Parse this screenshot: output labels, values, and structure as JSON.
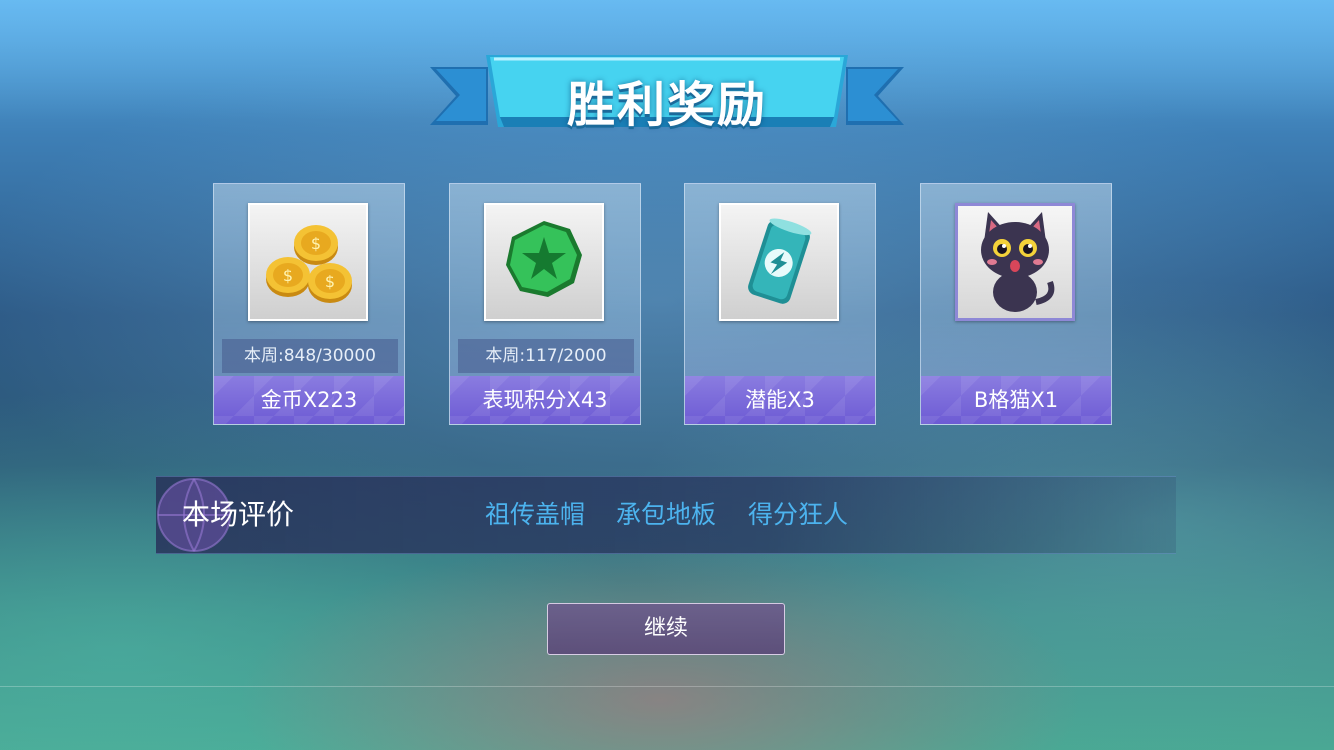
{
  "title": "胜利奖励",
  "rewards": [
    {
      "icon": "gold-coins-icon",
      "progress": "本周:848/30000",
      "label": "金币X223"
    },
    {
      "icon": "green-star-badge-icon",
      "progress": "本周:117/2000",
      "label": "表现积分X43"
    },
    {
      "icon": "energy-can-icon",
      "progress": "",
      "label": "潜能X3"
    },
    {
      "icon": "black-cat-icon",
      "progress": "",
      "label": "B格猫X1"
    }
  ],
  "evaluation": {
    "title": "本场评价",
    "tags": [
      "祖传盖帽",
      "承包地板",
      "得分狂人"
    ]
  },
  "continue_label": "继续",
  "colors": {
    "card_label": "#6d5bd4",
    "tag_text": "#4cb3ee",
    "banner": "#3bc8ec"
  }
}
